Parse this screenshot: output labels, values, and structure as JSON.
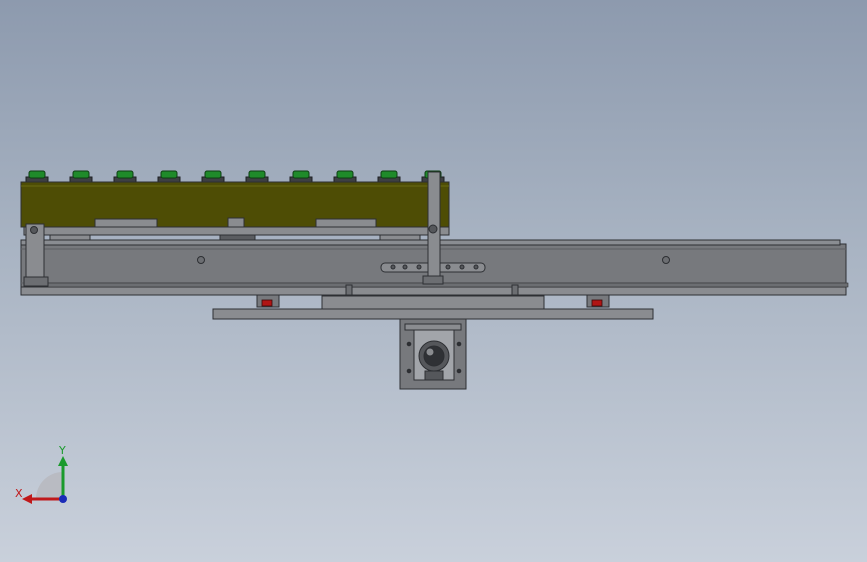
{
  "viewport": {
    "background_top": "#8d9aae",
    "background_bottom": "#c9d0db"
  },
  "model": {
    "fixture_plate_color": "#4e4d05",
    "frame_color": "#77797d",
    "edge_color": "#2d2f33",
    "pin_color": "#1f8a2a",
    "bearing_color": "#b01515",
    "pin_count": 10,
    "rail_holes": 3
  },
  "triad": {
    "x_label": "X",
    "y_label": "Y",
    "x_color": "#c0181a",
    "y_color": "#1a9a2c",
    "z_color": "#1a2bb8"
  }
}
